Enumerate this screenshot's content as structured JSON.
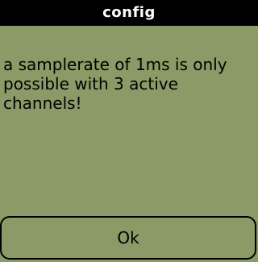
{
  "dialog": {
    "title": "config",
    "message": "a samplerate of 1ms is only\npossible with 3 active\nchannels!",
    "ok_label": "Ok"
  },
  "colors": {
    "background": "#8b9a66",
    "title_bar": "#000000",
    "title_text": "#ffffff",
    "text": "#000000"
  }
}
